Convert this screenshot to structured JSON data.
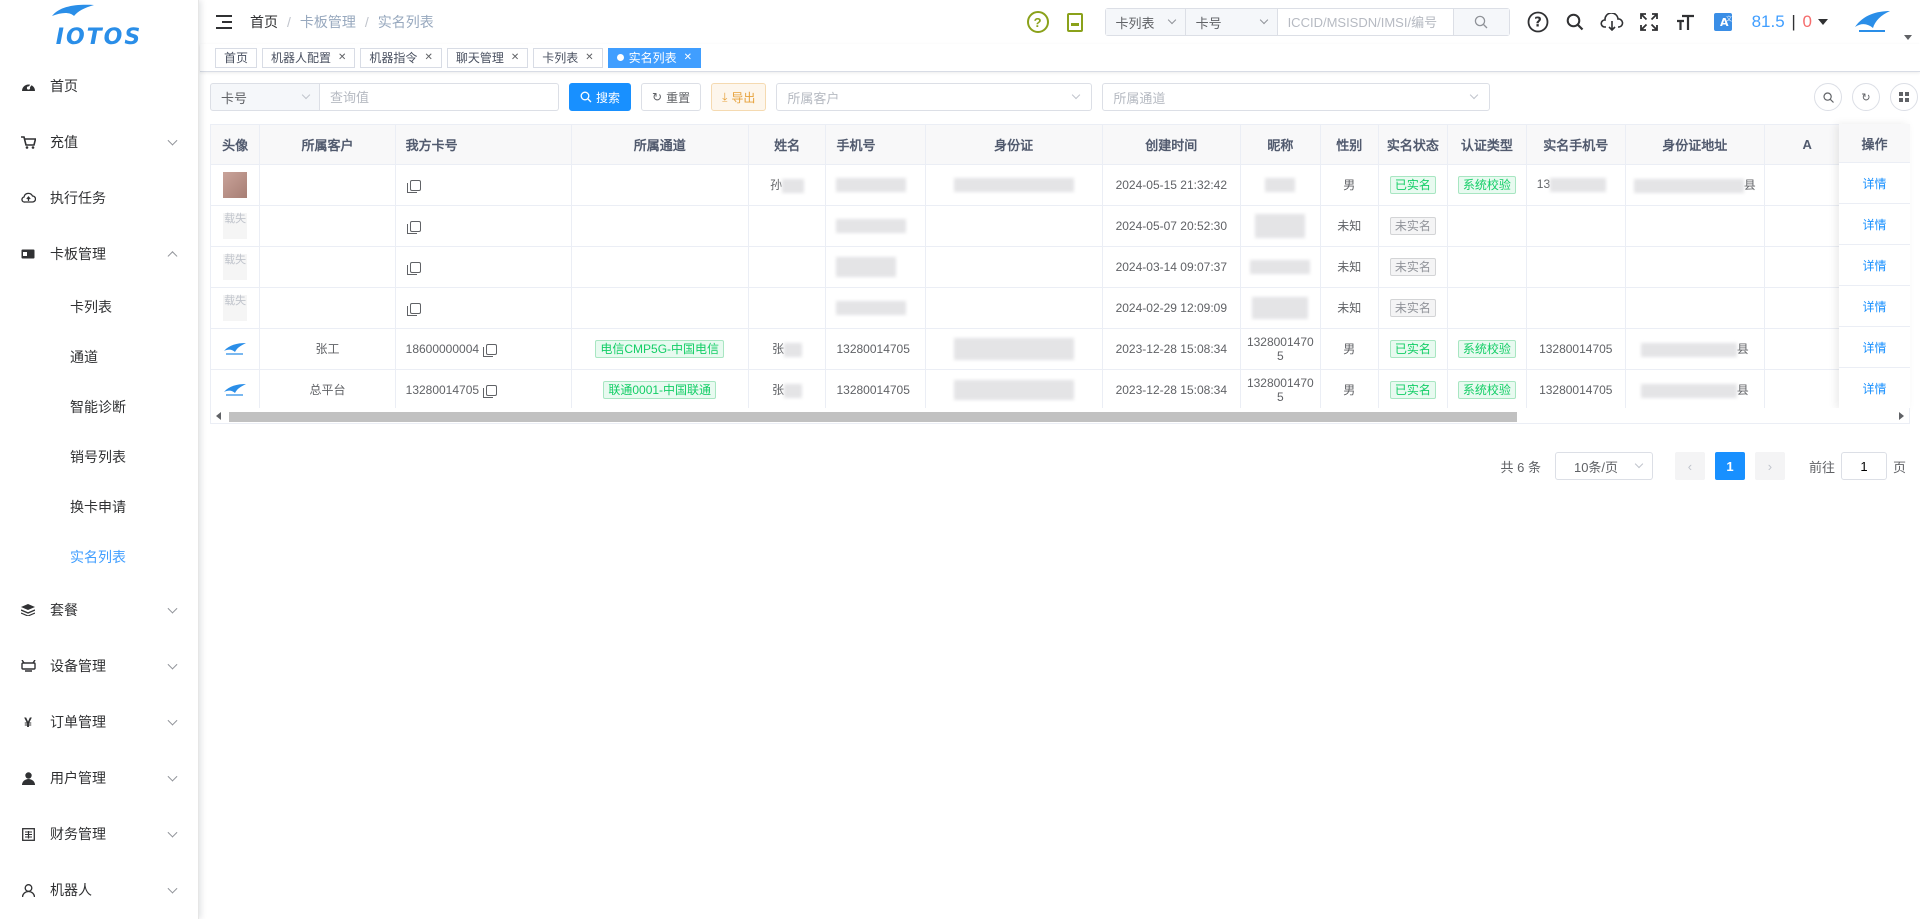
{
  "sidebar": {
    "logo": "IOTOS",
    "menu": [
      {
        "label": "首页",
        "icon": "dashboard-icon"
      },
      {
        "label": "充值",
        "icon": "cart-icon"
      },
      {
        "label": "执行任务",
        "icon": "cloud-icon"
      },
      {
        "label": "卡板管理",
        "icon": "card-icon"
      },
      {
        "label": "套餐",
        "icon": "layers-icon"
      },
      {
        "label": "设备管理",
        "icon": "device-icon"
      },
      {
        "label": "订单管理",
        "icon": "yen-icon"
      },
      {
        "label": "用户管理",
        "icon": "user-icon"
      },
      {
        "label": "财务管理",
        "icon": "finance-icon"
      },
      {
        "label": "机器人",
        "icon": "robot-icon"
      }
    ],
    "submenu": [
      "卡列表",
      "通道",
      "智能诊断",
      "销号列表",
      "换卡申请",
      "实名列表"
    ]
  },
  "breadcrumb": [
    "首页",
    "卡板管理",
    "实名列表"
  ],
  "header": {
    "search_type": "卡列表",
    "search_field": "卡号",
    "search_placeholder": "ICCID/MSISDN/IMSI/编号",
    "balance_value": "81.5",
    "balance_red": "0",
    "tool_icons": [
      "help-icon",
      "search-icon",
      "cloud-download-icon",
      "fullscreen-icon",
      "font-size-icon",
      "translate-icon"
    ]
  },
  "tags": [
    "首页",
    "机器人配置",
    "机器指令",
    "聊天管理",
    "卡列表",
    "实名列表"
  ],
  "filters": {
    "field_select": "卡号",
    "query_placeholder": "查询值",
    "search_btn": "搜索",
    "reset_btn": "重置",
    "export_btn": "导出",
    "customer_placeholder": "所属客户",
    "channel_placeholder": "所属通道"
  },
  "table": {
    "columns": [
      "头像",
      "所属客户",
      "我方卡号",
      "所属通道",
      "姓名",
      "手机号",
      "身份证",
      "创建时间",
      "昵称",
      "性别",
      "实名状态",
      "认证类型",
      "实名手机号",
      "身份证地址",
      "A",
      "操作"
    ],
    "rows": [
      {
        "avatar": "photo",
        "customer": "",
        "card": "",
        "channel": "",
        "name": "孙",
        "phone": "",
        "id": "",
        "created": "2024-05-15 21:32:42",
        "nick": "",
        "gender": "男",
        "status": "已实名",
        "auth": "系统校验",
        "rphone": "13",
        "addr": "县",
        "action": "详情"
      },
      {
        "avatar": "lost",
        "customer": "",
        "card": "",
        "channel": "",
        "name": "",
        "phone": "",
        "id": "",
        "created": "2024-05-07 20:52:30",
        "nick": "",
        "gender": "未知",
        "status": "未实名",
        "auth": "",
        "rphone": "",
        "addr": "",
        "action": "详情"
      },
      {
        "avatar": "lost",
        "customer": "",
        "card": "",
        "channel": "",
        "name": "",
        "phone": "",
        "id": "",
        "created": "2024-03-14 09:07:37",
        "nick": "",
        "gender": "未知",
        "status": "未实名",
        "auth": "",
        "rphone": "",
        "addr": "",
        "action": "详情"
      },
      {
        "avatar": "lost",
        "customer": "",
        "card": "",
        "channel": "",
        "name": "",
        "phone": "",
        "id": "",
        "created": "2024-02-29 12:09:09",
        "nick": "",
        "gender": "未知",
        "status": "未实名",
        "auth": "",
        "rphone": "",
        "addr": "",
        "action": "详情"
      },
      {
        "avatar": "logo",
        "customer": "张工",
        "card": "18600000004",
        "channel": "电信CMP5G-中国电信",
        "name": "张",
        "phone": "13280014705",
        "id": "",
        "created": "2023-12-28 15:08:34",
        "nick": "13280014705",
        "gender": "男",
        "status": "已实名",
        "auth": "系统校验",
        "rphone": "13280014705",
        "addr": "县",
        "action": "详情"
      },
      {
        "avatar": "logo",
        "customer": "总平台",
        "card": "13280014705",
        "channel": "联通0001-中国联通",
        "name": "张",
        "phone": "13280014705",
        "id": "",
        "created": "2023-12-28 15:08:34",
        "nick": "13280014705",
        "gender": "男",
        "status": "已实名",
        "auth": "系统校验",
        "rphone": "13280014705",
        "addr": "县",
        "action": "详情"
      }
    ],
    "avatar_lost_text": "载失"
  },
  "pagination": {
    "total": "共 6 条",
    "page_size": "10条/页",
    "current": "1",
    "goto_label": "前往",
    "goto_value": "1",
    "page_unit": "页"
  }
}
